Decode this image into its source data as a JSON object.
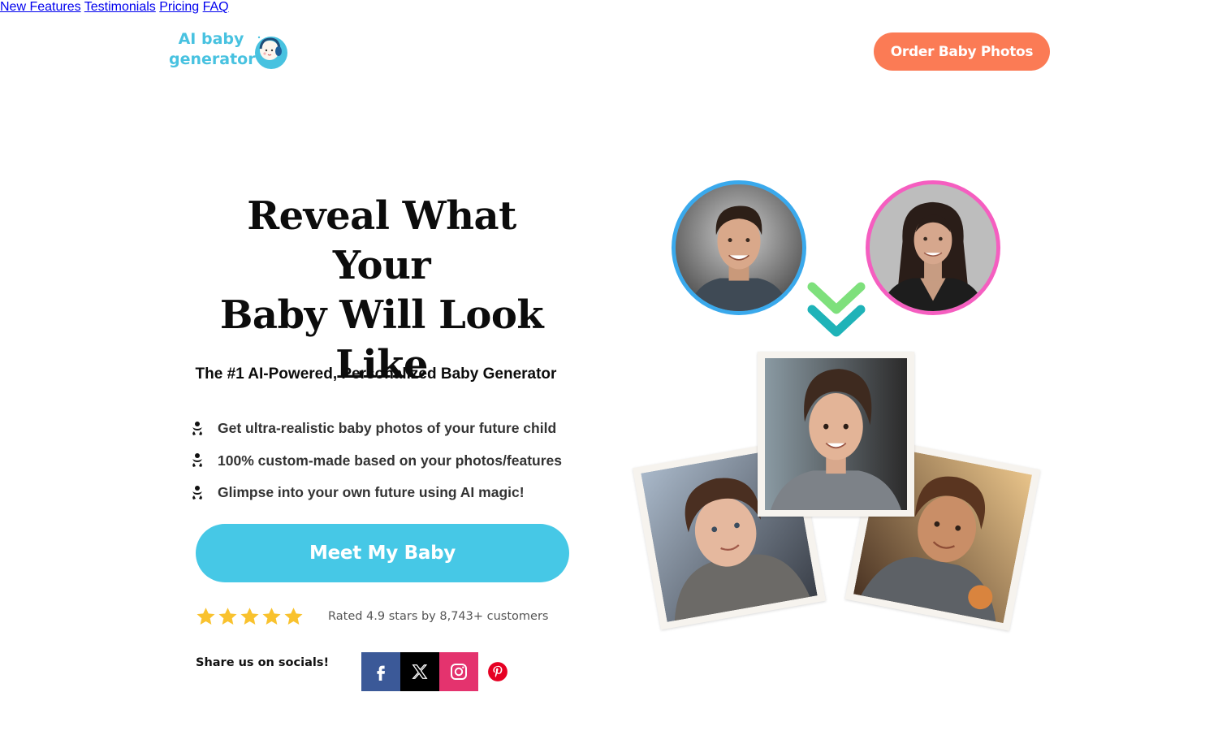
{
  "header": {
    "logo": {
      "line1": "AI baby",
      "line2": "generator",
      "icon": "baby-with-headphones-icon"
    },
    "nav": [
      {
        "label": "New Features"
      },
      {
        "label": "Testimonials"
      },
      {
        "label": "Pricing"
      },
      {
        "label": "FAQ"
      }
    ],
    "order_button": "Order Baby Photos"
  },
  "hero": {
    "title_lines": [
      "Reveal What Your",
      "Baby Will Look",
      "Like"
    ],
    "subtitle": "The #1 AI-Powered, Personalized Baby Generator",
    "features": [
      {
        "icon": "baby-icon",
        "text": "Get ultra-realistic baby photos of your future child"
      },
      {
        "icon": "baby-icon",
        "text": "100% custom-made based on your photos/features"
      },
      {
        "icon": "baby-icon",
        "text": "Glimpse into your own future using AI magic!"
      }
    ],
    "cta_label": "Meet My Baby",
    "rating": {
      "stars": 5,
      "value": 4.9,
      "text": "Rated 4.9 stars by 8,743+ customers"
    },
    "share_label": "Share us on socials!",
    "socials": [
      {
        "name": "facebook",
        "icon": "facebook-icon"
      },
      {
        "name": "x",
        "icon": "x-icon"
      },
      {
        "name": "instagram",
        "icon": "instagram-icon"
      },
      {
        "name": "pinterest",
        "icon": "pinterest-icon"
      }
    ]
  },
  "visual": {
    "parents": [
      {
        "role": "father-photo",
        "ring_color": "#3aa9ec"
      },
      {
        "role": "mother-photo",
        "ring_color": "#f55ec0"
      }
    ],
    "arrow": "double-chevron-down-icon",
    "children_photos": [
      "child-photo-left",
      "child-photo-center",
      "child-photo-right"
    ]
  },
  "colors": {
    "brand_blue": "#48c2e0",
    "cta_blue": "#46c8e6",
    "order_orange": "#fb7b55",
    "star_yellow": "#f9c22e",
    "chevron_green": "#7ee07c",
    "chevron_teal": "#1fb3b8"
  }
}
